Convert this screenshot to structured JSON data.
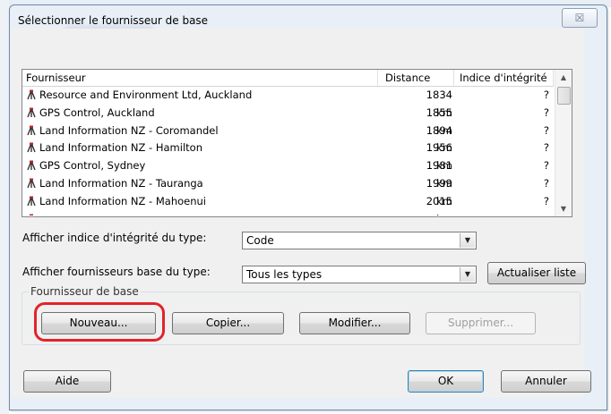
{
  "window": {
    "title": "Sélectionner le fournisseur de base",
    "close_glyph": "☒"
  },
  "list": {
    "columns": {
      "name": "Fournisseur",
      "distance": "Distance",
      "integrity": "Indice d'intégrité"
    },
    "rows": [
      {
        "name": "Resource and Environment Ltd, Auckland",
        "distance": "1834 km",
        "integrity": "?"
      },
      {
        "name": "GPS Control, Auckland",
        "distance": "1855 km",
        "integrity": "?"
      },
      {
        "name": "Land Information NZ - Coromandel",
        "distance": "1894 km",
        "integrity": "?"
      },
      {
        "name": "Land Information NZ - Hamilton",
        "distance": "1956 km",
        "integrity": "?"
      },
      {
        "name": "GPS Control, Sydney",
        "distance": "1981 km",
        "integrity": "?"
      },
      {
        "name": "Land Information NZ - Tauranga",
        "distance": "1999 km",
        "integrity": "?"
      },
      {
        "name": "Land Information NZ - Mahoenui",
        "distance": "2015 km",
        "integrity": "?"
      },
      {
        "name": "",
        "distance": "",
        "integrity": ""
      }
    ],
    "icon": "survey-tripod-icon",
    "scroll_up": "▲",
    "scroll_down": "▼"
  },
  "filters": {
    "integrity_label": "Afficher indice d'intégrité du type:",
    "integrity_value": "Code",
    "provider_label": "Afficher fournisseurs base du type:",
    "provider_value": "Tous les types",
    "dropdown_glyph": "▼",
    "refresh_button": "Actualiser liste"
  },
  "group": {
    "label": "Fournisseur de base",
    "new_button": "Nouveau...",
    "copy_button": "Copier...",
    "modify_button": "Modifier...",
    "delete_button": "Supprimer..."
  },
  "footer": {
    "help_button": "Aide",
    "ok_button": "OK",
    "cancel_button": "Annuler"
  },
  "colors": {
    "highlight": "#e0242b",
    "icon_red": "#b5282a",
    "icon_dark": "#333333"
  }
}
